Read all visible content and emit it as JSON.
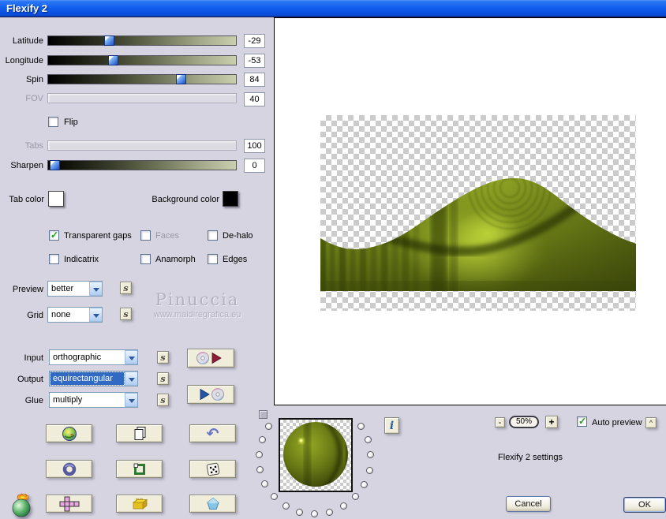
{
  "window": {
    "title": "Flexify 2"
  },
  "sliders": [
    {
      "label": "Latitude",
      "value": "-29"
    },
    {
      "label": "Longitude",
      "value": "-53"
    },
    {
      "label": "Spin",
      "value": "84"
    },
    {
      "label": "FOV",
      "value": "40"
    },
    {
      "label": "Tabs",
      "value": "100"
    },
    {
      "label": "Sharpen",
      "value": "0"
    }
  ],
  "checkboxes": {
    "flip": {
      "label": "Flip",
      "checked": false
    },
    "transparent_gaps": {
      "label": "Transparent gaps",
      "checked": true
    },
    "faces": {
      "label": "Faces",
      "checked": false
    },
    "dehalo": {
      "label": "De-halo",
      "checked": false
    },
    "indicatrix": {
      "label": "Indicatrix",
      "checked": false
    },
    "anamorph": {
      "label": "Anamorph",
      "checked": false
    },
    "edges": {
      "label": "Edges",
      "checked": false
    },
    "auto_preview": {
      "label": "Auto preview",
      "checked": true
    }
  },
  "color_pickers": {
    "tab_color": {
      "label": "Tab color",
      "color": "#ffffff"
    },
    "background_color": {
      "label": "Background color",
      "color": "#000000"
    }
  },
  "dropdowns": {
    "preview": {
      "label": "Preview",
      "value": "better"
    },
    "grid": {
      "label": "Grid",
      "value": "none"
    },
    "input": {
      "label": "Input",
      "value": "orthographic"
    },
    "output": {
      "label": "Output",
      "value": "equirectangular",
      "highlighted": true
    },
    "glue": {
      "label": "Glue",
      "value": "multiply"
    }
  },
  "small_buttons": {
    "s_label": "s",
    "info_label": "i",
    "collapse_label": "^",
    "minus": "-",
    "plus": "+"
  },
  "zoom_control": {
    "level": "50%"
  },
  "watermark": {
    "line1": "Pinuccia",
    "line2": "www.maidiregrafica.eu"
  },
  "footer": {
    "settings_text": "Flexify 2 settings",
    "cancel": "Cancel",
    "ok": "OK"
  },
  "icons": {
    "undo_glyph": "↶",
    "tool_buttons": [
      "globe-sphere-icon",
      "copy-pages-icon",
      "undo-arrow-icon",
      "torus-icon",
      "square-frame-icon",
      "dice-icon",
      "unfolded-cube-icon",
      "lego-brick-icon",
      "gem-icon"
    ],
    "io_buttons": [
      "disc-load-icon",
      "disc-save-icon"
    ],
    "logo": "flaming-pear-logo"
  },
  "colors": {
    "dialog_bg": "#d6d4e0",
    "titlebar_blue": "#1460ee",
    "selection_blue": "#316ac5",
    "olive": "#76891a",
    "cream_button": "#f0edda"
  }
}
